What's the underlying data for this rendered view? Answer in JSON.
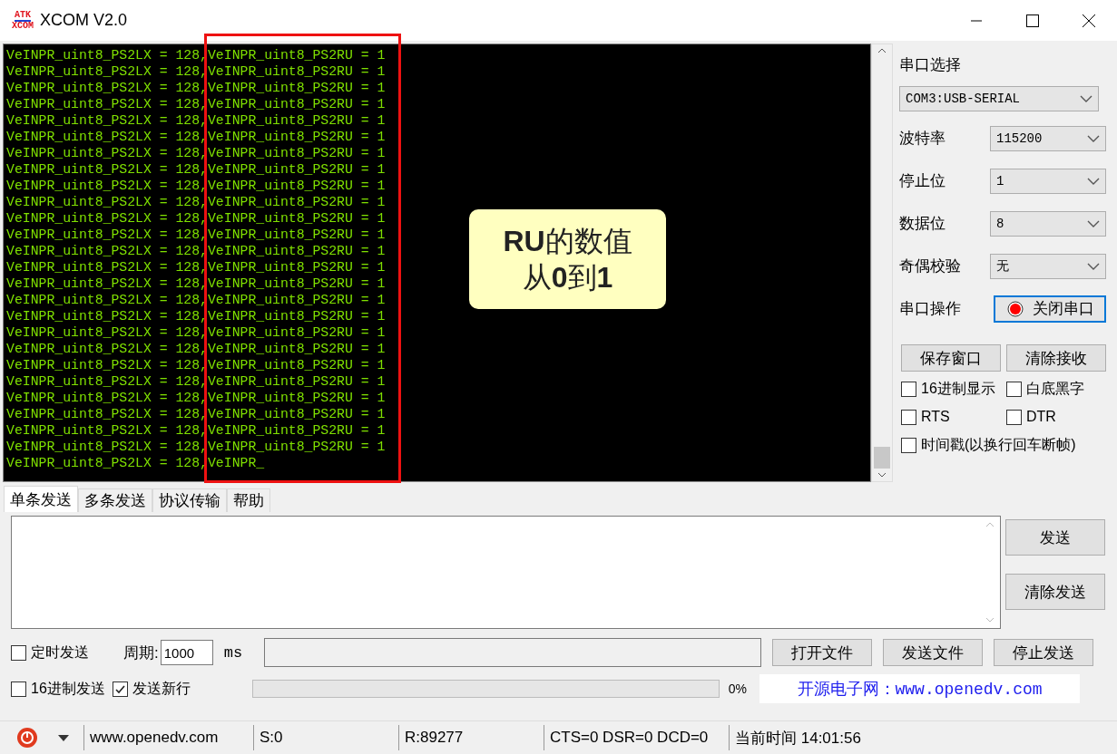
{
  "window": {
    "title": "XCOM V2.0",
    "logo_top": "ATK",
    "logo_bottom": "XCOM"
  },
  "terminal": {
    "lines": [
      "VeINPR_uint8_PS2LX = 128,VeINPR_uint8_PS2RU = 1",
      "VeINPR_uint8_PS2LX = 128,VeINPR_uint8_PS2RU = 1",
      "VeINPR_uint8_PS2LX = 128,VeINPR_uint8_PS2RU = 1",
      "VeINPR_uint8_PS2LX = 128,VeINPR_uint8_PS2RU = 1",
      "VeINPR_uint8_PS2LX = 128,VeINPR_uint8_PS2RU = 1",
      "VeINPR_uint8_PS2LX = 128,VeINPR_uint8_PS2RU = 1",
      "VeINPR_uint8_PS2LX = 128,VeINPR_uint8_PS2RU = 1",
      "VeINPR_uint8_PS2LX = 128,VeINPR_uint8_PS2RU = 1",
      "VeINPR_uint8_PS2LX = 128,VeINPR_uint8_PS2RU = 1",
      "VeINPR_uint8_PS2LX = 128,VeINPR_uint8_PS2RU = 1",
      "VeINPR_uint8_PS2LX = 128,VeINPR_uint8_PS2RU = 1",
      "VeINPR_uint8_PS2LX = 128,VeINPR_uint8_PS2RU = 1",
      "VeINPR_uint8_PS2LX = 128,VeINPR_uint8_PS2RU = 1",
      "VeINPR_uint8_PS2LX = 128,VeINPR_uint8_PS2RU = 1",
      "VeINPR_uint8_PS2LX = 128,VeINPR_uint8_PS2RU = 1",
      "VeINPR_uint8_PS2LX = 128,VeINPR_uint8_PS2RU = 1",
      "VeINPR_uint8_PS2LX = 128,VeINPR_uint8_PS2RU = 1",
      "VeINPR_uint8_PS2LX = 128,VeINPR_uint8_PS2RU = 1",
      "VeINPR_uint8_PS2LX = 128,VeINPR_uint8_PS2RU = 1",
      "VeINPR_uint8_PS2LX = 128,VeINPR_uint8_PS2RU = 1",
      "VeINPR_uint8_PS2LX = 128,VeINPR_uint8_PS2RU = 1",
      "VeINPR_uint8_PS2LX = 128,VeINPR_uint8_PS2RU = 1",
      "VeINPR_uint8_PS2LX = 128,VeINPR_uint8_PS2RU = 1",
      "VeINPR_uint8_PS2LX = 128,VeINPR_uint8_PS2RU = 1",
      "VeINPR_uint8_PS2LX = 128,VeINPR_uint8_PS2RU = 1",
      "VeINPR_uint8_PS2LX = 128,VeINPR_"
    ]
  },
  "callout": {
    "lines": [
      "**RU**的数值",
      "从**0**到**1**"
    ]
  },
  "serial_panel": {
    "port_label": "串口选择",
    "port": "COM3:USB-SERIAL",
    "settings": [
      {
        "label": "波特率",
        "value": "115200"
      },
      {
        "label": "停止位",
        "value": "1"
      },
      {
        "label": "数据位",
        "value": "8"
      },
      {
        "label": "奇偶校验",
        "value": "无"
      }
    ],
    "operation_label": "串口操作",
    "port_button": "关闭串口",
    "port_open": true,
    "buttons": [
      "保存窗口",
      "清除接收"
    ],
    "options": [
      {
        "label": "16进制显示",
        "checked": false
      },
      {
        "label": "白底黑字",
        "checked": false
      },
      {
        "label": "RTS",
        "checked": false
      },
      {
        "label": "DTR",
        "checked": false
      },
      {
        "label": "时间戳(以换行回车断帧)",
        "checked": false
      }
    ]
  },
  "tabs": [
    {
      "label": "单条发送",
      "selected": true
    },
    {
      "label": "多条发送",
      "selected": false
    },
    {
      "label": "协议传输",
      "selected": false
    },
    {
      "label": "帮助",
      "selected": false
    }
  ],
  "send_buttons": [
    "发送",
    "清除发送"
  ],
  "timed_send": {
    "label": "定时发送",
    "checked": false
  },
  "period": {
    "label": "周期:",
    "value": "1000",
    "unit": "ms"
  },
  "file_buttons": [
    "打开文件",
    "发送文件",
    "停止发送"
  ],
  "send_options": [
    {
      "label": "16进制发送",
      "checked": false
    },
    {
      "label": "发送新行",
      "checked": true
    }
  ],
  "progress": {
    "level": 0,
    "reading": "0%"
  },
  "banner": "开源电子网：www.openedv.com",
  "status_bar": {
    "site": "www.openedv.com",
    "sent": "S:0",
    "received": "R:89277",
    "lines": "CTS=0 DSR=0 DCD=0",
    "time": "当前时间 14:01:56"
  }
}
